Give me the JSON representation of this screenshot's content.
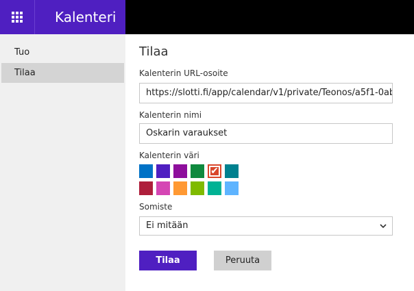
{
  "header": {
    "app_title": "Kalenteri",
    "app_launcher_icon": "waffle-grid-icon",
    "brand_color": "#4f1fc1"
  },
  "sidebar": {
    "items": [
      {
        "label": "Tuo",
        "active": false
      },
      {
        "label": "Tilaa",
        "active": true
      }
    ]
  },
  "form": {
    "title": "Tilaa",
    "url_label": "Kalenterin URL-osoite",
    "url_value": "https://slotti.fi/app/calendar/v1/private/Teonos/a5f1-0ab",
    "name_label": "Kalenterin nimi",
    "name_value": "Oskarin varaukset",
    "color_label": "Kalenterin väri",
    "colors": [
      "#0072c6",
      "#4f1fc1",
      "#8e0e9c",
      "#0f893e",
      "#d9472b",
      "#00818f",
      "#ae1e3b",
      "#d546b4",
      "#ff9933",
      "#7fba00",
      "#00b294",
      "#5eb4ff"
    ],
    "selected_color_index": 4,
    "charm_label": "Somiste",
    "charm_value": "Ei mitään",
    "submit_label": "Tilaa",
    "cancel_label": "Peruuta"
  }
}
